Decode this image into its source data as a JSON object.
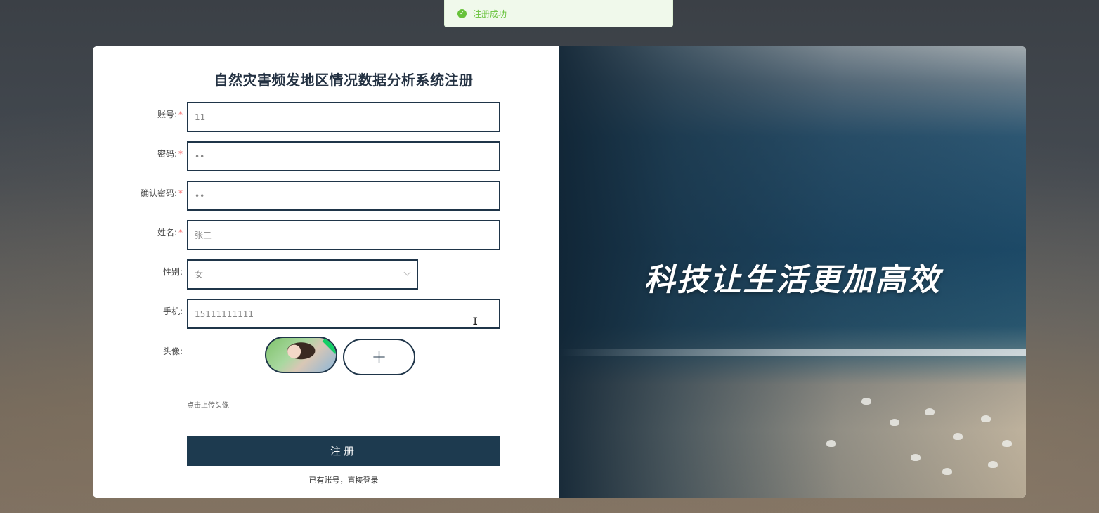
{
  "toast": {
    "icon": "check-circle-icon",
    "message": "注册成功",
    "color": "#67c23a"
  },
  "form": {
    "title": "自然灾害频发地区情况数据分析系统注册",
    "fields": {
      "account": {
        "label": "账号:",
        "required": "*",
        "value": "11"
      },
      "password": {
        "label": "密码:",
        "required": "*",
        "value": "••"
      },
      "confirm_password": {
        "label": "确认密码:",
        "required": "*",
        "value": "••"
      },
      "name": {
        "label": "姓名:",
        "required": "*",
        "value": "张三"
      },
      "gender": {
        "label": "性别:",
        "value": "女"
      },
      "phone": {
        "label": "手机:",
        "value": "15111111111"
      },
      "avatar": {
        "label": "头像:",
        "add_symbol": "+",
        "hint": "点击上传头像"
      }
    },
    "submit_label": "注册",
    "login_link": "已有账号，直接登录"
  },
  "banner": {
    "slogan": "科技让生活更加高效"
  },
  "colors": {
    "primary": "#1d3a4f",
    "border": "#1f3549",
    "required": "#f56c6c"
  }
}
